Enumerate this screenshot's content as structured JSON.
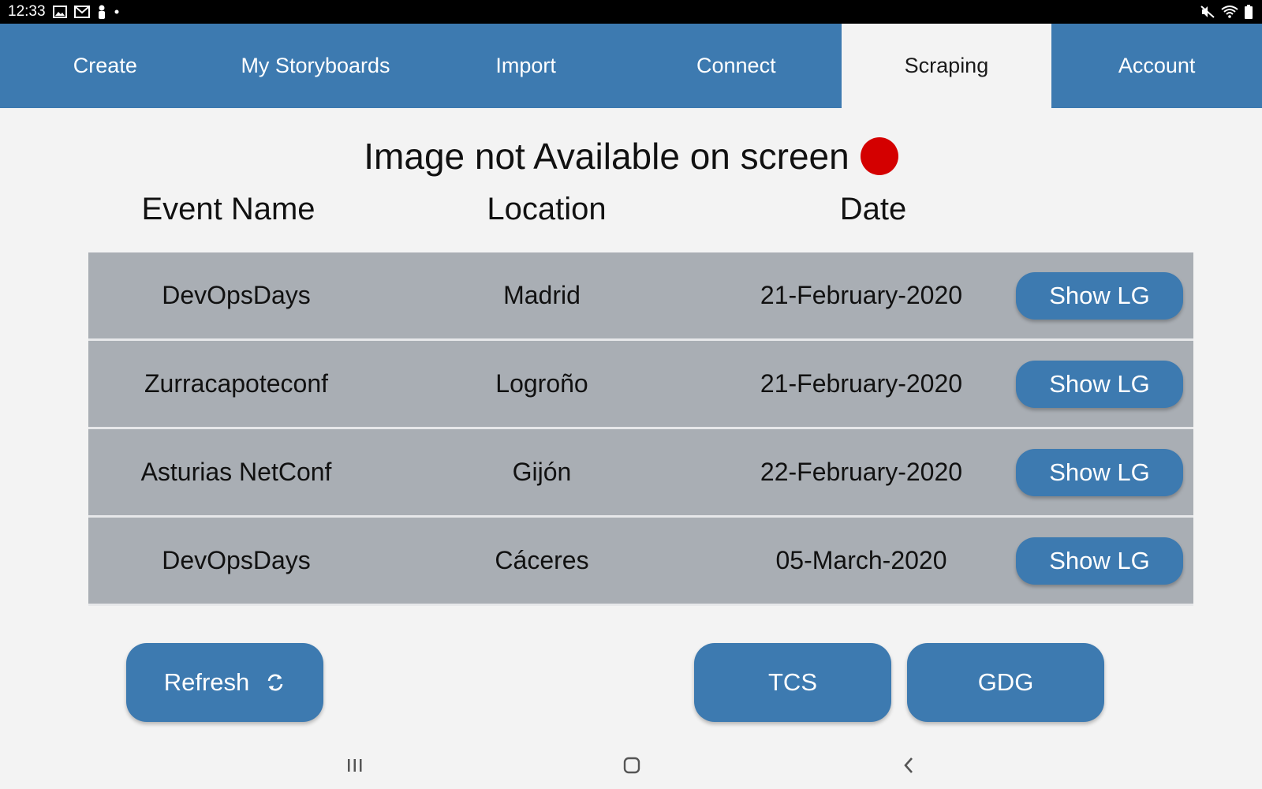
{
  "status_bar": {
    "time": "12:33",
    "left_icons": [
      "gallery-icon",
      "gmail-icon",
      "person-icon",
      "dot-icon"
    ],
    "right_icons": [
      "mute-icon",
      "wifi-icon",
      "battery-icon"
    ]
  },
  "tabs": [
    {
      "label": "Create",
      "active": false
    },
    {
      "label": "My Storyboards",
      "active": false
    },
    {
      "label": "Import",
      "active": false
    },
    {
      "label": "Connect",
      "active": false
    },
    {
      "label": "Scraping",
      "active": true
    },
    {
      "label": "Account",
      "active": false
    }
  ],
  "heading": {
    "text": "Image not Available on screen",
    "indicator_color": "#d40000"
  },
  "table": {
    "columns": [
      "Event Name",
      "Location",
      "Date"
    ],
    "button_label": "Show LG",
    "rows": [
      {
        "name": "DevOpsDays",
        "location": "Madrid",
        "date": "21-February-2020"
      },
      {
        "name": "Zurracapoteconf",
        "location": "Logroño",
        "date": "21-February-2020"
      },
      {
        "name": "Asturias NetConf",
        "location": "Gijón",
        "date": "22-February-2020"
      },
      {
        "name": "DevOpsDays",
        "location": "Cáceres",
        "date": "05-March-2020"
      }
    ]
  },
  "actions": {
    "refresh_label": "Refresh",
    "tcs_label": "TCS",
    "gdg_label": "GDG"
  },
  "colors": {
    "accent": "#3d7ab0",
    "row_bg": "#a9aeb4",
    "background": "#f3f3f3"
  },
  "nav_icons": [
    "recent-apps-icon",
    "home-icon",
    "back-icon"
  ]
}
